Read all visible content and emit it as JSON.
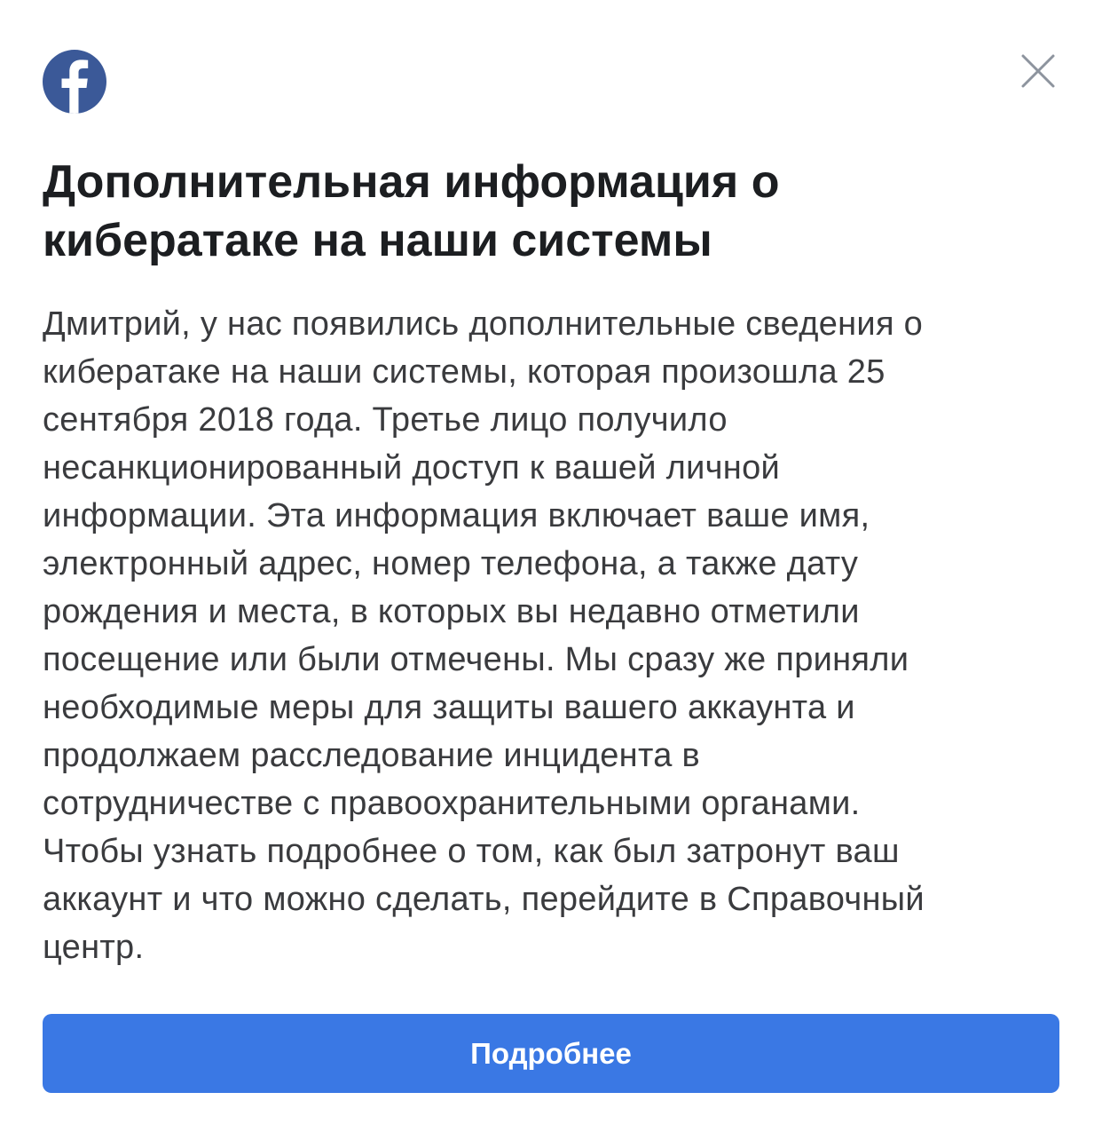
{
  "colors": {
    "facebook_blue": "#3b5998",
    "button_blue": "#3a78e4",
    "title_text": "#1c1e21",
    "body_text": "#3a3b3e",
    "close_icon": "#8d949e"
  },
  "icons": {
    "logo": "facebook-logo-icon",
    "close": "close-icon"
  },
  "dialog": {
    "title_lines": [
      "Дополнительная информация о",
      "кибератаке на наши системы"
    ],
    "body_lines": [
      "Дмитрий, у нас появились дополнительные сведения о",
      "кибератаке на наши системы, которая произошла 25",
      "сентября 2018 года. Третье лицо получило",
      "несанкционированный доступ к вашей личной",
      "информации. Эта информация включает ваше имя,",
      "электронный адрес, номер телефона, а также дату",
      "рождения и места, в которых вы недавно отметили",
      "посещение или были отмечены. Мы сразу же приняли",
      "необходимые меры для защиты вашего аккаунта и",
      "продолжаем расследование инцидента в",
      "сотрудничестве с правоохранительными органами.",
      "Чтобы узнать подробнее о том, как был затронут ваш",
      "аккаунт и что можно сделать, перейдите в Справочный",
      "центр."
    ],
    "primary_button_label": "Подробнее"
  }
}
